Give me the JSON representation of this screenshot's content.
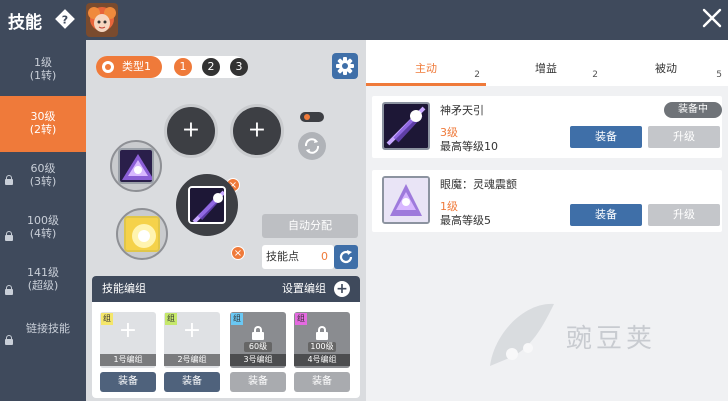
{
  "header": {
    "title": "技能"
  },
  "sidebar": {
    "items": [
      {
        "line1": "1级",
        "line2": "(1转)",
        "locked": false
      },
      {
        "line1": "30级",
        "line2": "(2转)",
        "locked": false,
        "active": true
      },
      {
        "line1": "60级",
        "line2": "(3转)",
        "locked": true
      },
      {
        "line1": "100级",
        "line2": "(4转)",
        "locked": true
      },
      {
        "line1": "141级",
        "line2": "(超级)",
        "locked": true
      },
      {
        "line1": "链接技能",
        "line2": "",
        "locked": true
      }
    ]
  },
  "presets": {
    "type_label": "类型1",
    "numbers": [
      "1",
      "2",
      "3"
    ]
  },
  "slots": {
    "plus_glyph": "+"
  },
  "auto_assign_label": "自动分配",
  "skill_points": {
    "label": "技能点",
    "value": "0"
  },
  "group_editor": {
    "title": "技能编组",
    "set_label": "设置编组",
    "tag": "组",
    "cards": [
      {
        "name": "1号编组",
        "level": "",
        "locked": false,
        "tag_color": "#f4e66a",
        "button": "装备"
      },
      {
        "name": "2号编组",
        "level": "",
        "locked": false,
        "tag_color": "#c5e86a",
        "button": "装备"
      },
      {
        "name": "3号编组",
        "level": "60级",
        "locked": true,
        "tag_color": "#6ac8f4",
        "button": "装备"
      },
      {
        "name": "4号编组",
        "level": "100级",
        "locked": true,
        "tag_color": "#e46ae0",
        "button": "装备"
      }
    ]
  },
  "tabs": [
    {
      "label": "主动",
      "count": "2",
      "active": true
    },
    {
      "label": "增益",
      "count": "2",
      "active": false
    },
    {
      "label": "被动",
      "count": "5",
      "active": false
    }
  ],
  "skills": [
    {
      "name": "神矛天引",
      "level": "3级",
      "max": "最高等级10",
      "equipped_badge": "装备中",
      "equip": "装备",
      "upgrade": "升级"
    },
    {
      "name": "眼魔：灵魂震颤",
      "level": "1级",
      "max": "最高等级5",
      "equip": "装备",
      "upgrade": "升级"
    }
  ],
  "watermark": {
    "text": "豌豆荚"
  },
  "colors": {
    "accent": "#ef7a3a",
    "header_bg": "#3f4a5c",
    "primary_button": "#3f6fa8"
  }
}
